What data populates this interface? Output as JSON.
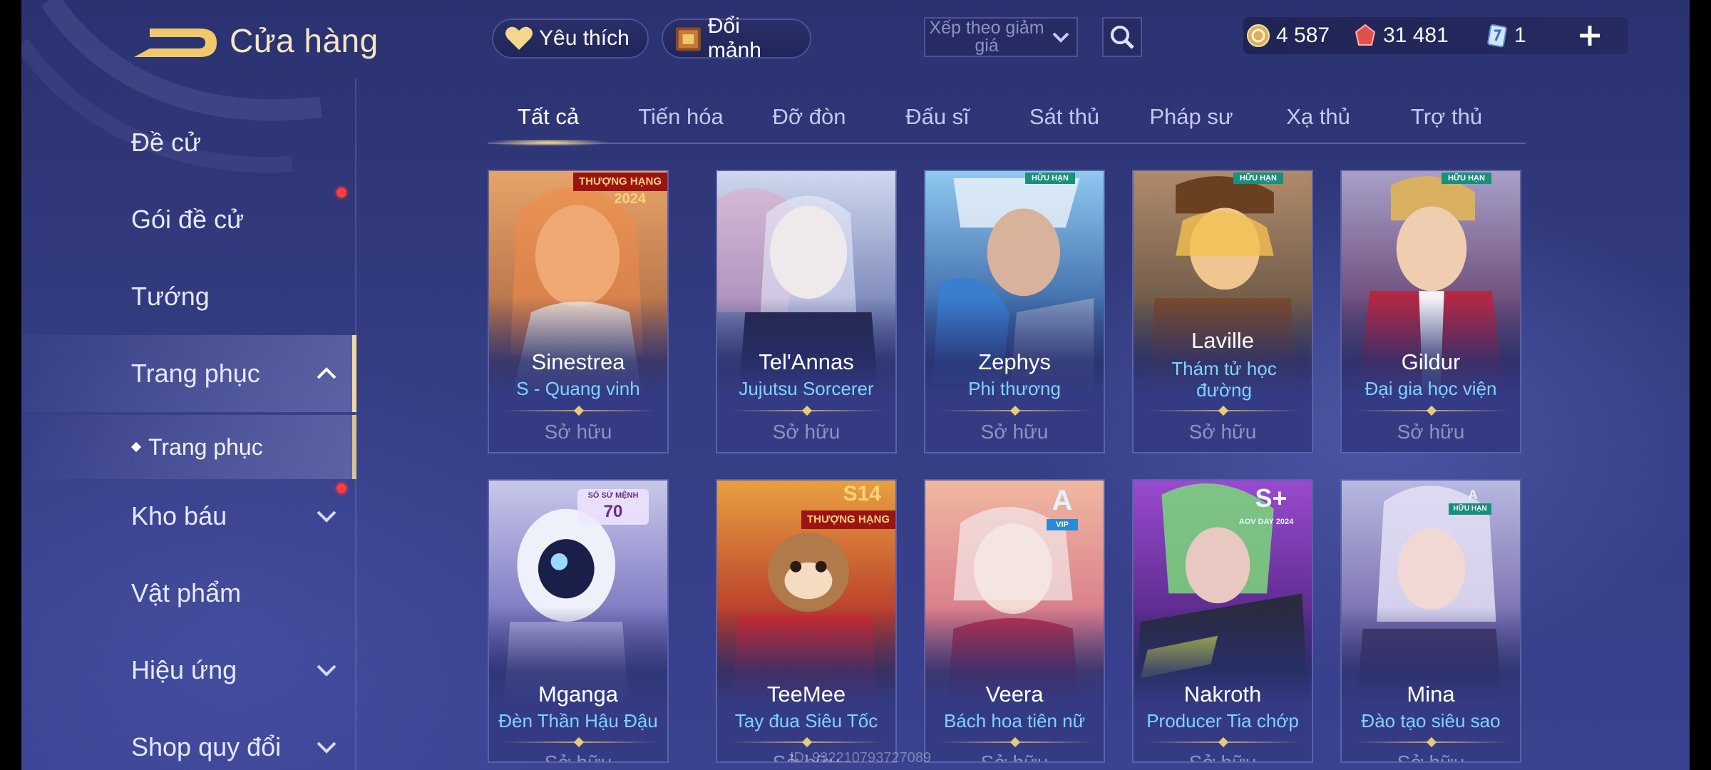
{
  "header": {
    "title": "Cửa hàng",
    "favorite_label": "Yêu thích",
    "exchange_label": "Đổi mảnh",
    "sort": {
      "label": "Xếp theo giảm giá"
    },
    "currencies": [
      {
        "name": "gold",
        "value": "4 587"
      },
      {
        "name": "gem",
        "value": "31 481"
      },
      {
        "name": "card",
        "value": "1"
      }
    ]
  },
  "sidebar": {
    "items": [
      {
        "label": "Đề cử"
      },
      {
        "label": "Gói đề cử"
      },
      {
        "label": "Tướng"
      },
      {
        "label": "Trang phục"
      },
      {
        "label": "Trang phục"
      },
      {
        "label": "Kho báu"
      },
      {
        "label": "Vật phẩm"
      },
      {
        "label": "Hiệu ứng"
      },
      {
        "label": "Shop quy đổi"
      }
    ]
  },
  "tabs": [
    "Tất cả",
    "Tiến hóa",
    "Đỡ đòn",
    "Đấu sĩ",
    "Sát thủ",
    "Pháp sư",
    "Xạ thủ",
    "Trợ thủ"
  ],
  "cards": [
    {
      "hero": "Sinestrea",
      "skin": "S - Quang vinh",
      "status": "Sở hữu",
      "badge": "THƯỢNG HẠNG",
      "badge2": "2024"
    },
    {
      "hero": "Tel'Annas",
      "skin": "Jujutsu Sorcerer",
      "status": "Sở hữu"
    },
    {
      "hero": "Zephys",
      "skin": "Phi thương",
      "status": "Sở hữu",
      "badge": "HỮU HẠN"
    },
    {
      "hero": "Laville",
      "skin": "Thám tử học đường",
      "status": "Sở hữu",
      "badge": "HỮU HẠN"
    },
    {
      "hero": "Gildur",
      "skin": "Đại gia học viện",
      "status": "Sở hữu",
      "badge": "HỮU HẠN"
    },
    {
      "hero": "Mganga",
      "skin": "Đèn Thần Hậu Đậu",
      "status": "Sở hữu",
      "badge": "SỔ SỨ MỆNH",
      "badge2": "70"
    },
    {
      "hero": "TeeMee",
      "skin": "Tay đua Siêu Tốc",
      "status": "Sở hữu",
      "badge": "THƯỢNG HẠNG",
      "badge2": "S14"
    },
    {
      "hero": "Veera",
      "skin": "Bách hoa tiên nữ",
      "status": "Sở hữu",
      "badge": "A",
      "badge2": "VIP"
    },
    {
      "hero": "Nakroth",
      "skin": "Producer Tia chớp",
      "status": "Sở hữu",
      "badge": "S+",
      "badge2": "AOV DAY 2024"
    },
    {
      "hero": "Mina",
      "skin": "Đào tạo siêu sao",
      "status": "Sở hữu",
      "badge": "A",
      "badge2": "HỮU HẠN"
    }
  ],
  "watermark": "ID: 932210793727089",
  "colors": {
    "background": "#343c82",
    "accent_gold": "#f1d9a0",
    "skin_name": "#7fd3ff",
    "notification": "#ff3b3b"
  }
}
